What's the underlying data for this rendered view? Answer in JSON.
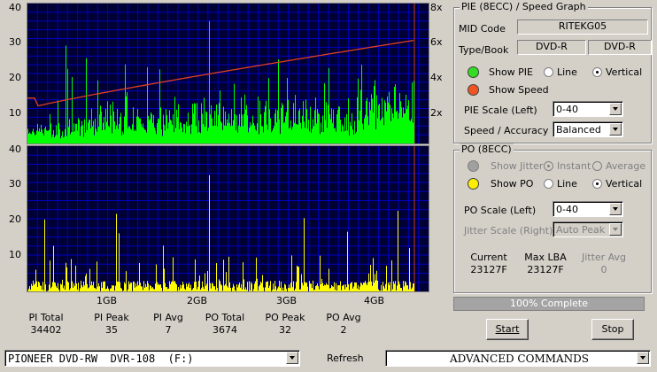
{
  "chart_data": [
    {
      "type": "bar",
      "title": "PIE (8ECC)",
      "ylim": [
        0,
        40
      ],
      "y_ticks": [
        "40",
        "30",
        "20",
        "10"
      ],
      "right_ticks": [
        "8x",
        "6x",
        "4x",
        "2x"
      ],
      "right_ylim": [
        0,
        8
      ],
      "x_ticks": [
        "1GB",
        "2GB",
        "3GB",
        "4GB"
      ],
      "xlim_gb": [
        0,
        4.37
      ],
      "grid": true,
      "series": [
        {
          "name": "PIE",
          "color": "#00ff00",
          "peak": 35,
          "average": 7
        },
        {
          "name": "Speed",
          "color": "#e04020",
          "type": "line",
          "start_x": 2.0,
          "end_x": 5.9
        }
      ]
    },
    {
      "type": "bar",
      "title": "PO (8ECC)",
      "ylim": [
        0,
        40
      ],
      "y_ticks": [
        "40",
        "30",
        "20",
        "10"
      ],
      "x_ticks": [
        "1GB",
        "2GB",
        "3GB",
        "4GB"
      ],
      "grid": true,
      "series": [
        {
          "name": "PO",
          "color": "#ffff00",
          "peak": 32,
          "average": 2
        }
      ]
    }
  ],
  "stats": [
    {
      "label": "PI Total",
      "value": "34402"
    },
    {
      "label": "PI Peak",
      "value": "35"
    },
    {
      "label": "PI Avg",
      "value": "7"
    },
    {
      "label": "PO Total",
      "value": "3674"
    },
    {
      "label": "PO Peak",
      "value": "32"
    },
    {
      "label": "PO Avg",
      "value": "2"
    }
  ],
  "pie_panel": {
    "title": "PIE (8ECC) / Speed Graph",
    "mid_code_label": "MID Code",
    "mid_code": "RITEKG05",
    "type_book_label": "Type/Book",
    "type": "DVD-R",
    "book": "DVD-R",
    "show_pie": "Show PIE",
    "show_speed": "Show Speed",
    "line": "Line",
    "vertical": "Vertical",
    "scale_label": "PIE Scale (Left)",
    "scale_value": "0-40",
    "speed_label": "Speed / Accuracy",
    "speed_value": "Balanced",
    "pie_color": "#33dd22",
    "speed_color": "#ee5522"
  },
  "po_panel": {
    "title": "PO (8ECC)",
    "show_jitter": "Show Jitter",
    "instant": "Instant",
    "average": "Average",
    "show_po": "Show PO",
    "line": "Line",
    "vertical": "Vertical",
    "scale_label": "PO Scale (Left)",
    "scale_value": "0-40",
    "jitter_label": "Jitter Scale (Right)",
    "jitter_value": "Auto Peak",
    "current_label": "Current",
    "current_value": "23127F",
    "maxlba_label": "Max LBA",
    "maxlba_value": "23127F",
    "jitter_avg_label": "Jitter Avg",
    "jitter_avg_value": "0",
    "po_color": "#ffee00",
    "jitter_color": "#a0a0a0"
  },
  "progress": {
    "text": "100% Complete",
    "fraction": 1.0
  },
  "buttons": {
    "start": "Start",
    "stop": "Stop",
    "refresh": "Refresh"
  },
  "drive": "PIONEER DVD-RW  DVR-108  (F:)",
  "advanced": "ADVANCED COMMANDS"
}
